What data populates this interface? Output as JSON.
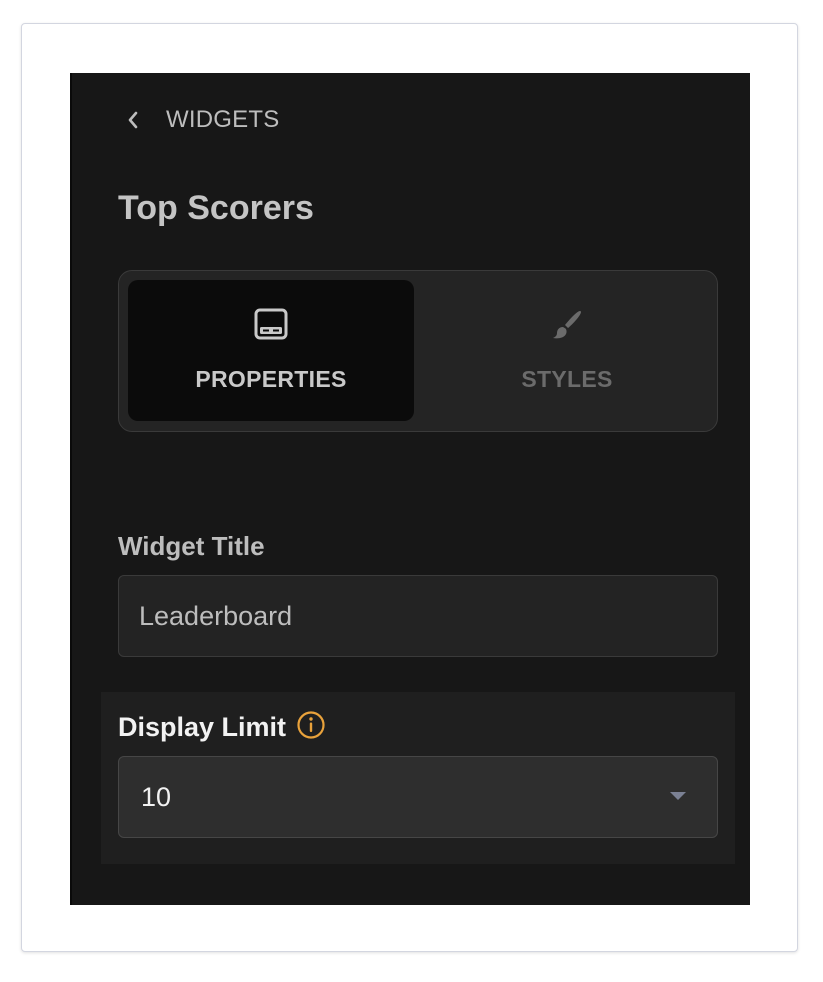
{
  "header": {
    "back_label": "WIDGETS",
    "back_icon": "chevron-left-icon",
    "widget_name": "Top Scorers"
  },
  "tabs": [
    {
      "label": "PROPERTIES",
      "icon": "panel-icon",
      "active": true
    },
    {
      "label": "STYLES",
      "icon": "paintbrush-icon",
      "active": false
    }
  ],
  "fields": {
    "widget_title": {
      "label": "Widget Title",
      "value": "Leaderboard"
    },
    "display_limit": {
      "label": "Display Limit",
      "value": "10",
      "info_icon": "info-icon",
      "dropdown_icon": "caret-down-icon"
    }
  },
  "colors": {
    "panel_bg": "#171717",
    "accent_info": "#e9a23b",
    "text_primary": "#f2f2f2",
    "text_muted": "#bdbdbd"
  }
}
